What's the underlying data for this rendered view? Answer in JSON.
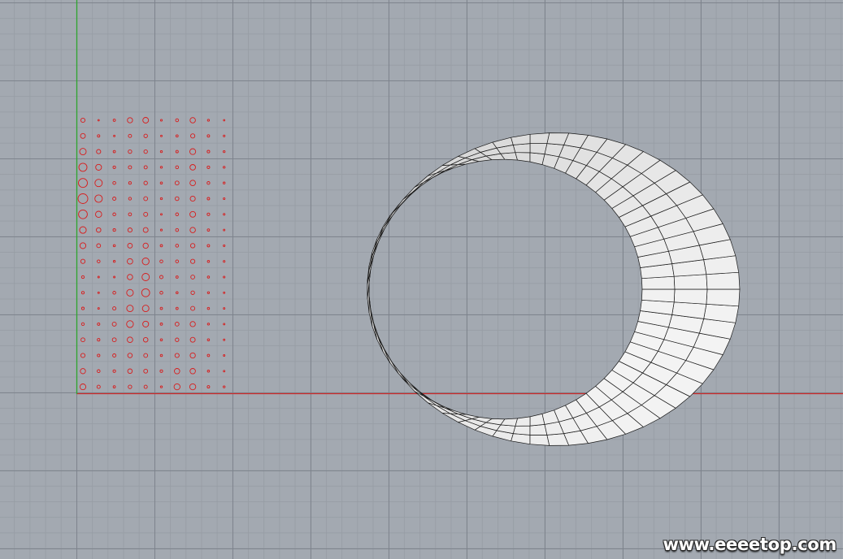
{
  "viewport": {
    "background_color": "#a3a9b1",
    "major_grid_color": "#7d838c",
    "minor_grid_color": "#969ca4",
    "x_axis_color": "#cc2b2b",
    "y_axis_color": "#2ea52e"
  },
  "point_grid": {
    "color": "#d81c1c",
    "columns": 10,
    "rows": 18,
    "radius_pattern": [
      [
        2.6,
        0.9,
        1.4,
        3.2,
        3.5,
        1.1,
        1.8,
        3.3,
        1.2,
        0.9
      ],
      [
        3.0,
        1.5,
        1.0,
        2.0,
        2.2,
        1.0,
        1.4,
        2.6,
        1.5,
        1.1
      ],
      [
        4.0,
        2.6,
        1.4,
        2.2,
        2.2,
        1.2,
        1.5,
        3.6,
        1.6,
        1.2
      ],
      [
        5.0,
        3.6,
        1.6,
        2.0,
        2.0,
        1.2,
        1.8,
        3.4,
        1.6,
        1.2
      ],
      [
        5.5,
        4.5,
        1.8,
        1.6,
        2.2,
        1.3,
        2.4,
        3.4,
        1.7,
        1.2
      ],
      [
        6.0,
        4.6,
        2.0,
        1.7,
        2.4,
        1.2,
        2.3,
        3.1,
        1.5,
        1.1
      ],
      [
        5.4,
        3.8,
        1.8,
        1.9,
        2.5,
        1.0,
        1.8,
        3.5,
        1.6,
        1.1
      ],
      [
        4.1,
        2.8,
        1.6,
        2.6,
        3.0,
        1.1,
        1.8,
        3.3,
        1.4,
        1.0
      ],
      [
        3.6,
        2.4,
        1.3,
        2.9,
        3.2,
        1.4,
        1.8,
        2.7,
        1.5,
        1.1
      ],
      [
        2.6,
        1.8,
        1.2,
        3.4,
        4.2,
        1.8,
        1.8,
        2.6,
        1.3,
        1.1
      ],
      [
        1.7,
        1.0,
        1.0,
        3.3,
        4.5,
        2.0,
        1.4,
        2.4,
        1.3,
        1.1
      ],
      [
        1.6,
        1.0,
        1.8,
        4.1,
        4.9,
        1.8,
        1.3,
        2.2,
        1.2,
        1.0
      ],
      [
        1.6,
        1.0,
        2.0,
        4.0,
        4.0,
        1.4,
        1.4,
        2.5,
        1.3,
        1.0
      ],
      [
        1.7,
        1.5,
        2.5,
        4.2,
        3.6,
        1.4,
        2.4,
        3.2,
        1.2,
        1.0
      ],
      [
        2.4,
        1.6,
        2.4,
        3.4,
        2.8,
        1.3,
        2.2,
        3.0,
        1.3,
        1.0
      ],
      [
        2.6,
        1.6,
        2.0,
        2.8,
        2.4,
        1.3,
        2.6,
        3.2,
        1.4,
        1.0
      ],
      [
        3.2,
        1.8,
        1.6,
        2.8,
        2.4,
        1.6,
        3.3,
        3.3,
        1.3,
        1.0
      ],
      [
        3.6,
        2.0,
        1.4,
        2.2,
        2.0,
        1.2,
        3.7,
        3.7,
        1.5,
        1.2
      ]
    ]
  },
  "mobius_surface": {
    "fill_light": "#f3f3f3",
    "fill_dark": "#c3c3c3",
    "edge_color": "#1a1a1a",
    "segments": 64,
    "width_divisions": 3
  },
  "watermark": {
    "text": "www.eeeetop.com"
  }
}
